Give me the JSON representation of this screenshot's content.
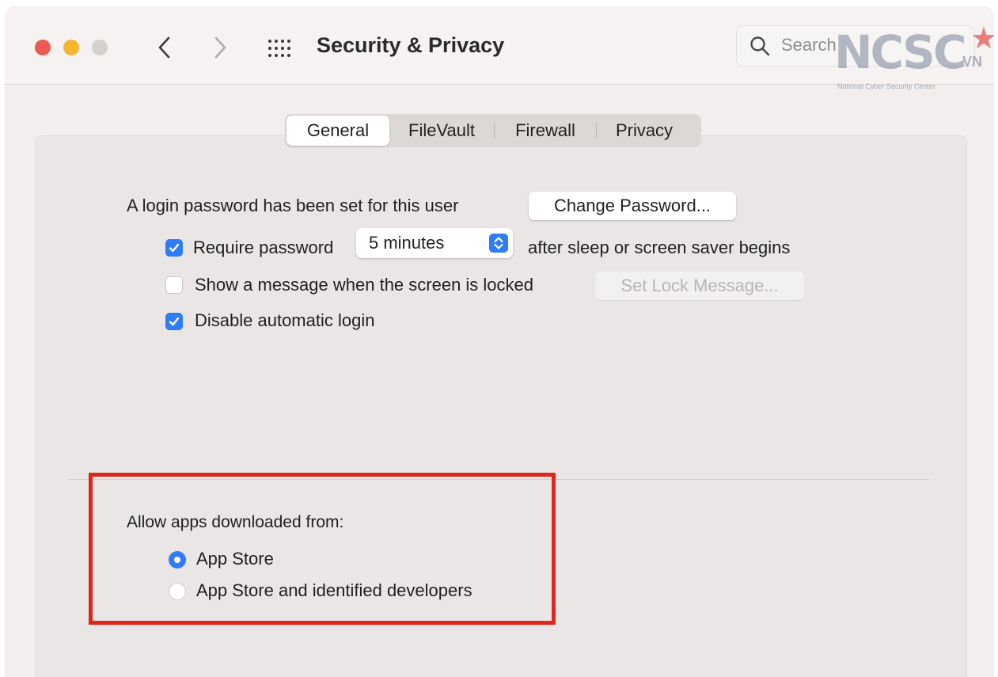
{
  "window": {
    "title": "Security & Privacy"
  },
  "search": {
    "placeholder": "Search"
  },
  "watermark": {
    "text": "NCSC",
    "suffix": "VN",
    "subtitle": "National Cyber Security Center"
  },
  "tabs": [
    {
      "label": "General",
      "active": true
    },
    {
      "label": "FileVault",
      "active": false
    },
    {
      "label": "Firewall",
      "active": false
    },
    {
      "label": "Privacy",
      "active": false
    }
  ],
  "general": {
    "login_password_text": "A login password has been set for this user",
    "change_password_label": "Change Password...",
    "require_password": {
      "label": "Require password",
      "checked": true,
      "delay_value": "5 minutes",
      "suffix": "after sleep or screen saver begins"
    },
    "show_message": {
      "label": "Show a message when the screen is locked",
      "checked": false,
      "button_label": "Set Lock Message..."
    },
    "disable_auto_login": {
      "label": "Disable automatic login",
      "checked": true
    }
  },
  "allow_apps": {
    "heading": "Allow apps downloaded from:",
    "options": [
      {
        "label": "App Store",
        "selected": true
      },
      {
        "label": "App Store and identified developers",
        "selected": false
      }
    ]
  },
  "colors": {
    "accent": "#2f7cf6",
    "highlight_border": "#e0261c"
  }
}
